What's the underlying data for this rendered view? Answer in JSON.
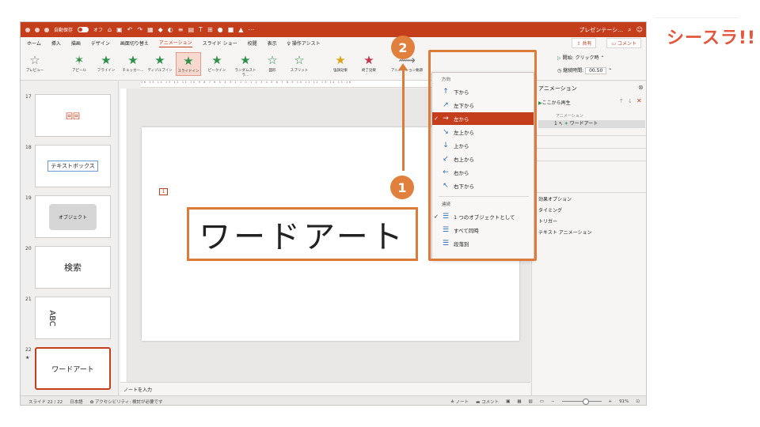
{
  "app": {
    "autosave_label": "自動保存",
    "autosave_state": "オフ",
    "doc_title": "プレゼンテーシ…",
    "accent_color": "#c43e1c",
    "annotation_color": "#dd7b3a"
  },
  "tabs": [
    "ホーム",
    "挿入",
    "描画",
    "デザイン",
    "画面切り替え",
    "アニメーション",
    "スライド ショー",
    "校閲",
    "表示",
    "操作アシスト"
  ],
  "tab_active": "アニメーション",
  "share_label": "共有",
  "comment_label": "コメント",
  "ribbon": {
    "preview": "プレビュー",
    "effects": [
      "アピール",
      "フライイン",
      "チェッカー…",
      "ディゾルブイン",
      "スライドイン",
      "ピークイン",
      "ランダムストラ…",
      "図形",
      "スプリット"
    ],
    "emphasis": "強調効果",
    "exit": "終了効果",
    "anim_path": "アニメーション軌跡",
    "start_label": "開始:",
    "start_value": "クリック時",
    "duration_label": "継続時間:",
    "duration_value": "00.50"
  },
  "slides": [
    {
      "num": "17",
      "text": "回回"
    },
    {
      "num": "18",
      "text": "テキストボックス"
    },
    {
      "num": "19",
      "text": "オブジェクト"
    },
    {
      "num": "20",
      "text": "検索"
    },
    {
      "num": "21",
      "text": "ABC"
    },
    {
      "num": "22",
      "text": "ワードアート",
      "marker": "★"
    }
  ],
  "ruler_text": "16 15 14 13 12 11 10 9 8 7 6 5 4 3 2 1 0 1 2 3 4 5 6 7 8 9 10 11 12 13 14 15 16",
  "slide_main": {
    "anim_tag": "1",
    "wordart": "ワードアート"
  },
  "notes_placeholder": "ノートを入力",
  "anim_pane": {
    "title": "アニメーション",
    "play_from": "ここから再生",
    "list_header": "アニメーション",
    "item_num": "1",
    "item_label": "ワードアート",
    "sections": [
      "効果オプション",
      "タイミング",
      "トリガー",
      "テキスト アニメーション"
    ]
  },
  "dropdown": {
    "direction_header": "方向",
    "directions": [
      {
        "icon": "↑",
        "label": "下から"
      },
      {
        "icon": "↗",
        "label": "左下から"
      },
      {
        "icon": "→",
        "label": "左から",
        "checked": true
      },
      {
        "icon": "↘",
        "label": "左上から"
      },
      {
        "icon": "↓",
        "label": "上から"
      },
      {
        "icon": "↙",
        "label": "右上から"
      },
      {
        "icon": "←",
        "label": "右から"
      },
      {
        "icon": "↖",
        "label": "右下から"
      }
    ],
    "sequence_header": "連続",
    "sequences": [
      {
        "label": "1 つのオブジェクトとして",
        "checked": true
      },
      {
        "label": "すべて同時"
      },
      {
        "label": "段落別"
      }
    ]
  },
  "status": {
    "slide_info": "スライド 22 / 22",
    "language": "日本語",
    "accessibility": "アクセシビリティ: 検討が必要です",
    "notes": "ノート",
    "comments": "コメント",
    "zoom": "91%"
  },
  "badges": {
    "b1": "1",
    "b2": "2"
  },
  "logo": "シースラ!!"
}
